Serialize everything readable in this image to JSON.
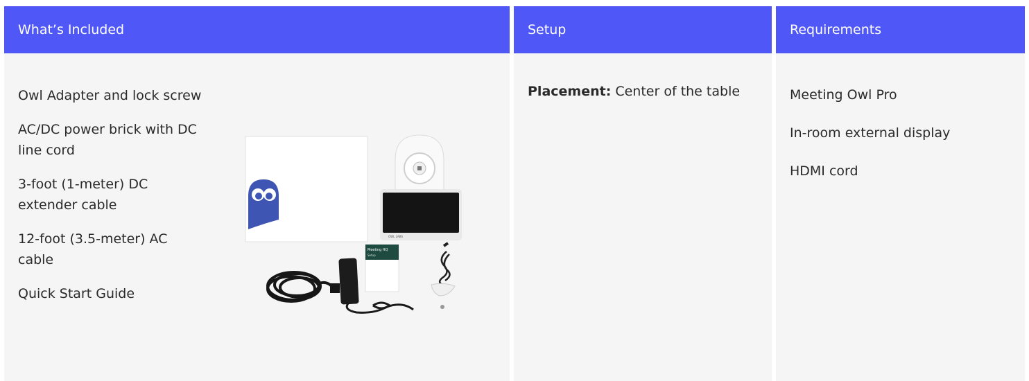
{
  "columns": [
    {
      "header": "What’s Included",
      "items": [
        "Owl Adapter and lock screw",
        "AC/DC power brick with DC line cord",
        "3-foot (1-meter) DC extender cable",
        "12-foot (3.5-meter) AC cable",
        "Quick Start Guide"
      ]
    },
    {
      "header": "Setup",
      "placement_label": "Placement:",
      "placement_value": " Center of the table"
    },
    {
      "header": "Requirements",
      "items": [
        "Meeting Owl Pro",
        "In-room external display",
        "HDMI cord"
      ]
    }
  ],
  "product_image": {
    "guide_title": "Meeting HQ",
    "guide_subtitle": "Setup",
    "colors": {
      "brand_blue": "#4f57f7",
      "owl_blue": "#3f55b4",
      "guide_green": "#1f4a3f"
    }
  }
}
